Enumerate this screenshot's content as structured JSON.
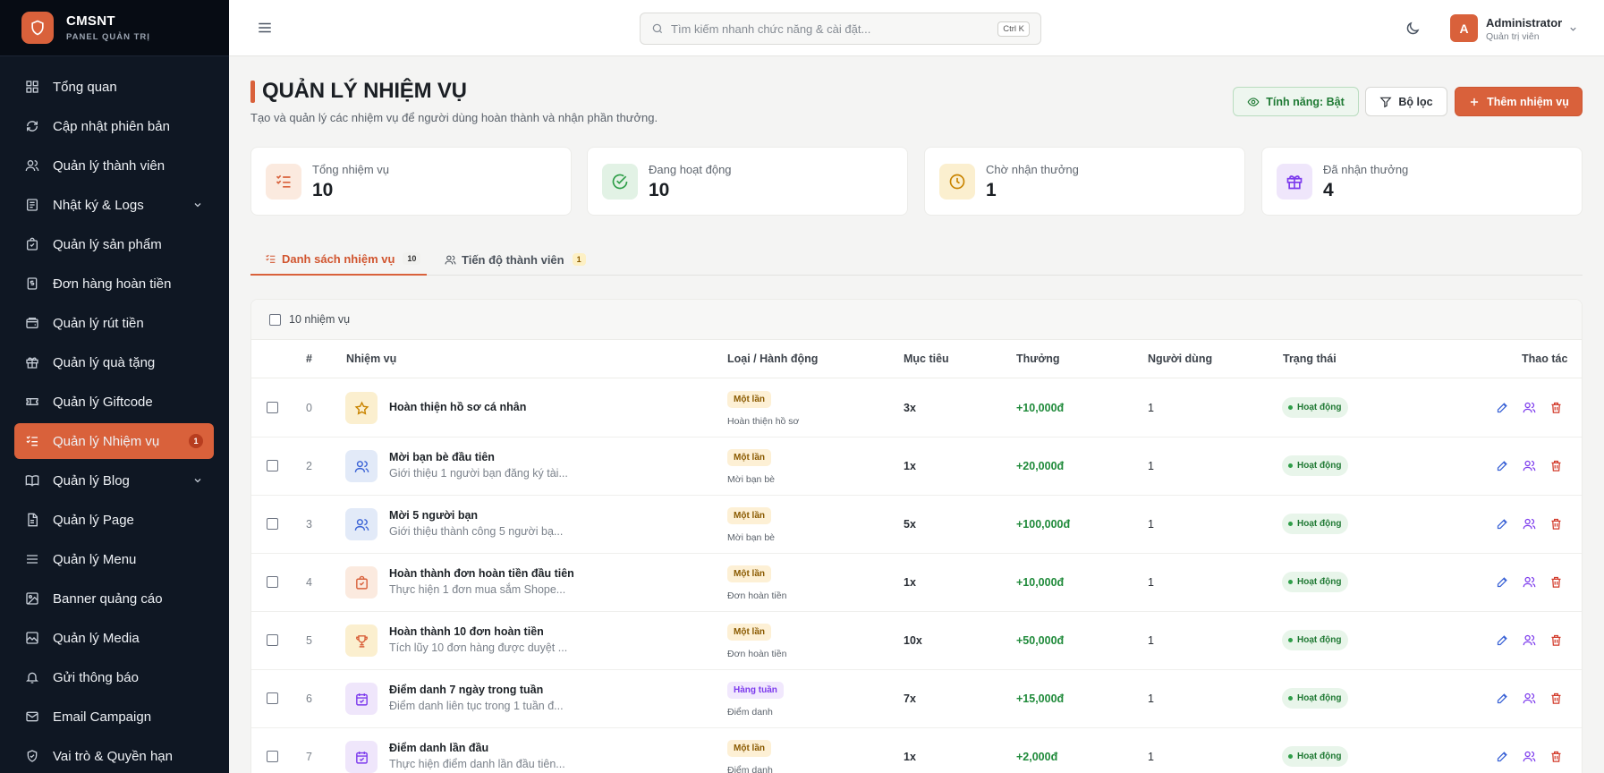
{
  "brand": {
    "name": "CMSNT",
    "subtitle": "PANEL QUẢN TRỊ"
  },
  "sidebar": {
    "items": [
      {
        "label": "Tổng quan",
        "icon": "dashboard-icon"
      },
      {
        "label": "Cập nhật phiên bản",
        "icon": "update-icon"
      },
      {
        "label": "Quản lý thành viên",
        "icon": "users-icon"
      },
      {
        "label": "Nhật ký & Logs",
        "icon": "logs-icon",
        "expandable": true
      },
      {
        "label": "Quản lý sản phẩm",
        "icon": "product-icon"
      },
      {
        "label": "Đơn hàng hoàn tiền",
        "icon": "refund-order-icon"
      },
      {
        "label": "Quản lý rút tiền",
        "icon": "withdraw-icon"
      },
      {
        "label": "Quản lý quà tặng",
        "icon": "gift-icon"
      },
      {
        "label": "Quản lý Giftcode",
        "icon": "ticket-icon"
      },
      {
        "label": "Quản lý Nhiệm vụ",
        "icon": "task-list-icon",
        "active": true,
        "badge": "1"
      },
      {
        "label": "Quản lý Blog",
        "icon": "book-icon",
        "expandable": true
      },
      {
        "label": "Quản lý Page",
        "icon": "page-icon"
      },
      {
        "label": "Quản lý Menu",
        "icon": "menu-icon"
      },
      {
        "label": "Banner quảng cáo",
        "icon": "image-icon"
      },
      {
        "label": "Quản lý Media",
        "icon": "media-icon"
      },
      {
        "label": "Gửi thông báo",
        "icon": "bell-icon"
      },
      {
        "label": "Email Campaign",
        "icon": "mail-icon"
      },
      {
        "label": "Vai trò & Quyền hạn",
        "icon": "shield-check-icon"
      }
    ]
  },
  "topbar": {
    "search_placeholder": "Tìm kiếm nhanh chức năng & cài đặt...",
    "search_shortcut": "Ctrl K",
    "user": {
      "initial": "A",
      "name": "Administrator",
      "role": "Quản trị viên"
    }
  },
  "page": {
    "title": "QUẢN LÝ NHIỆM VỤ",
    "subtitle": "Tạo và quản lý các nhiệm vụ để người dùng hoàn thành và nhận phần thưởng.",
    "buttons": {
      "feature": "Tính năng: Bật",
      "filter": "Bộ lọc",
      "add": "Thêm nhiệm vụ"
    }
  },
  "stats": [
    {
      "label": "Tổng nhiệm vụ",
      "value": "10",
      "icon": "task-list-icon"
    },
    {
      "label": "Đang hoạt động",
      "value": "10",
      "icon": "check-circle-icon"
    },
    {
      "label": "Chờ nhận thưởng",
      "value": "1",
      "icon": "clock-icon"
    },
    {
      "label": "Đã nhận thưởng",
      "value": "4",
      "icon": "gift-icon"
    }
  ],
  "tabs": [
    {
      "label": "Danh sách nhiệm vụ",
      "badge": "10",
      "active": true
    },
    {
      "label": "Tiến độ thành viên",
      "badge": "1"
    }
  ],
  "table": {
    "count_label": "10 nhiệm vụ",
    "headers": {
      "idx": "#",
      "task": "Nhiệm vụ",
      "type": "Loại / Hành động",
      "goal": "Mục tiêu",
      "reward": "Thưởng",
      "users": "Người dùng",
      "status": "Trạng thái",
      "actions": "Thao tác"
    },
    "rows": [
      {
        "idx": "0",
        "title": "Hoàn thiện hồ sơ cá nhân",
        "desc": "",
        "icon": "star-icon",
        "type": "Một lần",
        "action": "Hoàn thiện hồ sơ",
        "goal": "3x",
        "reward": "+10,000đ",
        "users": "1",
        "status": "Hoạt động"
      },
      {
        "idx": "2",
        "title": "Mời bạn bè đầu tiên",
        "desc": "Giới thiệu 1 người bạn đăng ký tài...",
        "icon": "users-icon",
        "type": "Một lần",
        "action": "Mời bạn bè",
        "goal": "1x",
        "reward": "+20,000đ",
        "users": "1",
        "status": "Hoạt động"
      },
      {
        "idx": "3",
        "title": "Mời 5 người bạn",
        "desc": "Giới thiệu thành công 5 người bạ...",
        "icon": "users-icon",
        "type": "Một lần",
        "action": "Mời bạn bè",
        "goal": "5x",
        "reward": "+100,000đ",
        "users": "1",
        "status": "Hoạt động"
      },
      {
        "idx": "4",
        "title": "Hoàn thành đơn hoàn tiền đầu tiên",
        "desc": "Thực hiện 1 đơn mua sắm Shope...",
        "icon": "shopping-bag-icon",
        "type": "Một lần",
        "action": "Đơn hoàn tiền",
        "goal": "1x",
        "reward": "+10,000đ",
        "users": "1",
        "status": "Hoạt động"
      },
      {
        "idx": "5",
        "title": "Hoàn thành 10 đơn hoàn tiền",
        "desc": "Tích lũy 10 đơn hàng được duyệt ...",
        "icon": "trophy-icon",
        "type": "Một lần",
        "action": "Đơn hoàn tiền",
        "goal": "10x",
        "reward": "+50,000đ",
        "users": "1",
        "status": "Hoạt động"
      },
      {
        "idx": "6",
        "title": "Điểm danh 7 ngày trong tuần",
        "desc": "Điểm danh liên tục trong 1 tuần đ...",
        "icon": "calendar-check-icon",
        "type": "Hàng tuần",
        "action": "Điểm danh",
        "goal": "7x",
        "reward": "+15,000đ",
        "users": "1",
        "status": "Hoạt động"
      },
      {
        "idx": "7",
        "title": "Điểm danh lần đầu",
        "desc": "Thực hiện điểm danh lần đầu tiên...",
        "icon": "calendar-check-icon",
        "type": "Một lần",
        "action": "Điểm danh",
        "goal": "1x",
        "reward": "+2,000đ",
        "users": "1",
        "status": "Hoạt động"
      }
    ]
  },
  "colors": {
    "accent": "#d9613b",
    "sidebar_bg": "#0f1723",
    "success": "#1f8a3a",
    "weekly": "#7c3aed"
  }
}
